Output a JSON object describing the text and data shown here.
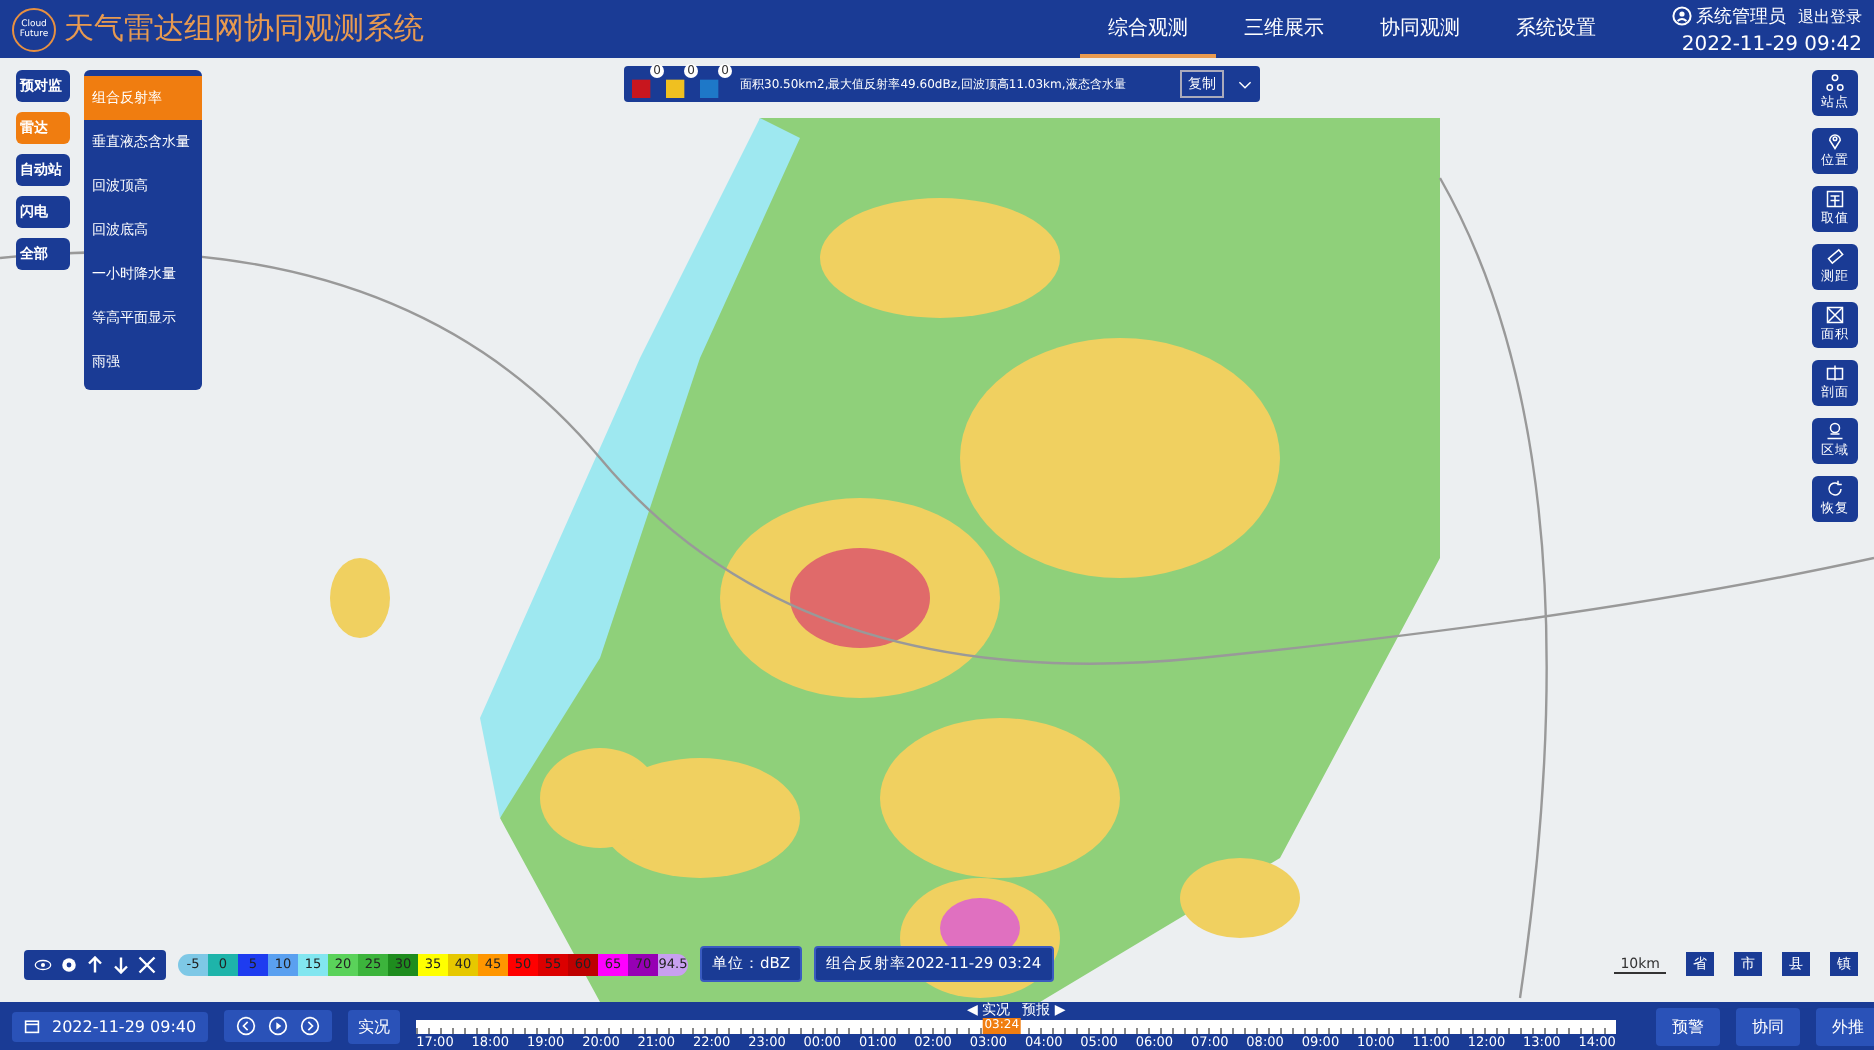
{
  "app": {
    "title": "天气雷达组网协同观测系统",
    "logo_text": "Cloud Future"
  },
  "nav": [
    {
      "label": "综合观测",
      "selected": true
    },
    {
      "label": "三维展示",
      "selected": false
    },
    {
      "label": "协同观测",
      "selected": false
    },
    {
      "label": "系统设置",
      "selected": false
    }
  ],
  "user": {
    "name": "系统管理员",
    "logout": "退出登录",
    "datetime": "2022-11-29 09:42"
  },
  "categories": [
    {
      "label": "预对监",
      "selected": false
    },
    {
      "label": "雷达",
      "selected": true
    },
    {
      "label": "自动站",
      "selected": false
    },
    {
      "label": "闪电",
      "selected": false
    },
    {
      "label": "全部",
      "selected": false
    }
  ],
  "products": [
    {
      "label": "组合反射率",
      "selected": true
    },
    {
      "label": "垂直液态含水量",
      "selected": false
    },
    {
      "label": "回波顶高",
      "selected": false
    },
    {
      "label": "回波底高",
      "selected": false
    },
    {
      "label": "一小时降水量",
      "selected": false
    },
    {
      "label": "等高平面显示",
      "selected": false
    },
    {
      "label": "雨强",
      "selected": false
    }
  ],
  "alerts": [
    {
      "count": "0",
      "color": "#c8161e"
    },
    {
      "count": "0",
      "color": "#f0c020"
    },
    {
      "count": "0",
      "color": "#1e78c8"
    }
  ],
  "info": {
    "text": "面积30.50km2,最大值反射率49.60dBz,回波顶高11.03km,液态含水量",
    "copy": "复制"
  },
  "tools": [
    {
      "kind": "station",
      "label": "站点"
    },
    {
      "kind": "pin",
      "label": "位置"
    },
    {
      "kind": "value",
      "label": "取值"
    },
    {
      "kind": "ruler",
      "label": "测距"
    },
    {
      "kind": "area",
      "label": "面积"
    },
    {
      "kind": "section",
      "label": "剖面"
    },
    {
      "kind": "region",
      "label": "区域"
    },
    {
      "kind": "reset",
      "label": "恢复"
    }
  ],
  "legend": [
    {
      "label": "-5",
      "color": "#7ec8e6"
    },
    {
      "label": "0",
      "color": "#1eb4aa"
    },
    {
      "label": "5",
      "color": "#1e3cf0"
    },
    {
      "label": "10",
      "color": "#5aa0f0"
    },
    {
      "label": "15",
      "color": "#82e6f0"
    },
    {
      "label": "20",
      "color": "#5ad25a"
    },
    {
      "label": "25",
      "color": "#3cb43c"
    },
    {
      "label": "30",
      "color": "#1e8c1e"
    },
    {
      "label": "35",
      "color": "#ffff00"
    },
    {
      "label": "40",
      "color": "#e6c800"
    },
    {
      "label": "45",
      "color": "#ff9600"
    },
    {
      "label": "50",
      "color": "#ff0000"
    },
    {
      "label": "55",
      "color": "#dc0000"
    },
    {
      "label": "60",
      "color": "#be0000"
    },
    {
      "label": "65",
      "color": "#ff00ff"
    },
    {
      "label": "70",
      "color": "#9600b4"
    },
    {
      "label": "94.5",
      "color": "#c8a0f0"
    }
  ],
  "unit": "单位：dBZ",
  "product_time": "组合反射率2022-11-29 03:24",
  "scale": "10km",
  "levels": [
    "省",
    "市",
    "县",
    "镇"
  ],
  "footer": {
    "date": "2022-11-29 09:40",
    "live": "实况",
    "obs": "◀ 实况",
    "forecast": "预报 ▶",
    "current": "03:24",
    "level": 0.488,
    "hours": [
      "17:00",
      "18:00",
      "19:00",
      "20:00",
      "21:00",
      "22:00",
      "23:00",
      "00:00",
      "01:00",
      "02:00",
      "03:00",
      "04:00",
      "05:00",
      "06:00",
      "07:00",
      "08:00",
      "09:00",
      "10:00",
      "11:00",
      "12:00",
      "13:00",
      "14:00"
    ],
    "actions": [
      "预警",
      "协同",
      "外推"
    ]
  }
}
